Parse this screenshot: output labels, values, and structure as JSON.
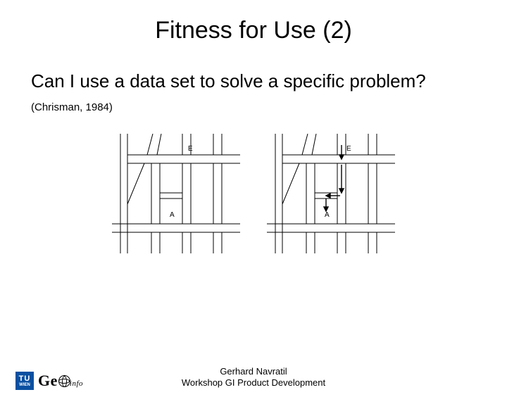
{
  "title": "Fitness for Use (2)",
  "question": "Can I use a data set to solve a specific problem?",
  "citation": "(Chrisman, 1984)",
  "map_labels": {
    "E": "E",
    "A": "A"
  },
  "footer": {
    "author": "Gerhard Navratil",
    "event": "Workshop GI Product Development"
  },
  "logo": {
    "tu_top": "TU",
    "tu_bottom": "WIEN",
    "geo_prefix": "Ge",
    "info_suffix": "info"
  }
}
